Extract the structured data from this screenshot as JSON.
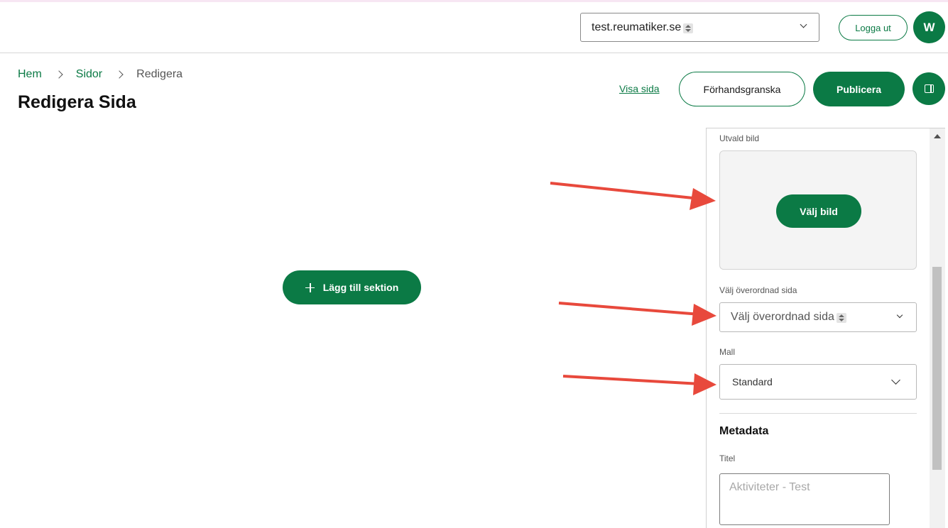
{
  "header": {
    "site_select_value": "test.reumatiker.se",
    "logout_label": "Logga ut",
    "avatar_initial": "W"
  },
  "breadcrumb": {
    "items": [
      "Hem",
      "Sidor",
      "Redigera"
    ]
  },
  "page": {
    "title": "Redigera Sida",
    "view_link": "Visa sida",
    "preview_label": "Förhandsgranska",
    "publish_label": "Publicera",
    "add_section_label": "Lägg till sektion"
  },
  "side_panel": {
    "featured_image_label": "Utvald bild",
    "choose_image_label": "Välj bild",
    "parent_page_label": "Välj överordnad sida",
    "parent_page_value": "Välj överordnad sida",
    "template_label": "Mall",
    "template_value": "Standard",
    "metadata_heading": "Metadata",
    "title_label": "Titel",
    "title_placeholder": "Aktiviteter - Test"
  },
  "colors": {
    "brand_green": "#0b7a45",
    "annotation_arrow": "#e8493c"
  }
}
